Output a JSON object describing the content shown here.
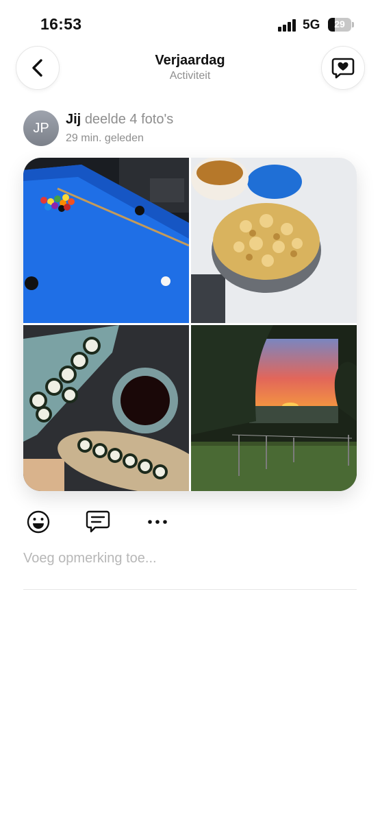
{
  "status_bar": {
    "time": "16:53",
    "network": "5G",
    "battery": "29",
    "battery_level_pct": 29
  },
  "nav": {
    "title": "Verjaardag",
    "subtitle": "Activiteit"
  },
  "post": {
    "avatar_initials": "JP",
    "author": "Jij",
    "action": "deelde 4 foto's",
    "time": "29 min. geleden"
  },
  "photos": [
    {
      "icon": "pool-table-photo"
    },
    {
      "icon": "crumble-pie-photo"
    },
    {
      "icon": "sushi-photo"
    },
    {
      "icon": "sunset-landscape-photo"
    }
  ],
  "actions": {
    "react_icon": "smiley-icon",
    "comment_icon": "comment-icon",
    "more_icon": "more-icon"
  },
  "comment": {
    "placeholder": "Voeg opmerking toe..."
  },
  "colors": {
    "accent_text": "#111111",
    "muted_text": "#8e8e8e",
    "placeholder": "#b7b7b7"
  }
}
